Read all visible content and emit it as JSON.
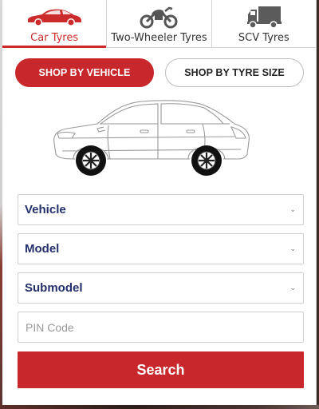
{
  "tabs": [
    {
      "label": "Car Tyres",
      "icon": "car-icon",
      "active": true
    },
    {
      "label": "Two-Wheeler Tyres",
      "icon": "motorcycle-icon",
      "active": false
    },
    {
      "label": "SCV Tyres",
      "icon": "truck-icon",
      "active": false
    }
  ],
  "shop_modes": {
    "by_vehicle": "SHOP BY VEHICLE",
    "by_tyre_size": "SHOP BY TYRE SIZE",
    "selected": "by_vehicle"
  },
  "illustration": {
    "icon": "car-outline-illustration"
  },
  "form": {
    "vehicle": "Vehicle",
    "model": "Model",
    "submodel": "Submodel",
    "pin_placeholder": "PIN Code",
    "search_label": "Search"
  },
  "colors": {
    "accent": "#c8282b",
    "label_navy": "#24306b"
  }
}
